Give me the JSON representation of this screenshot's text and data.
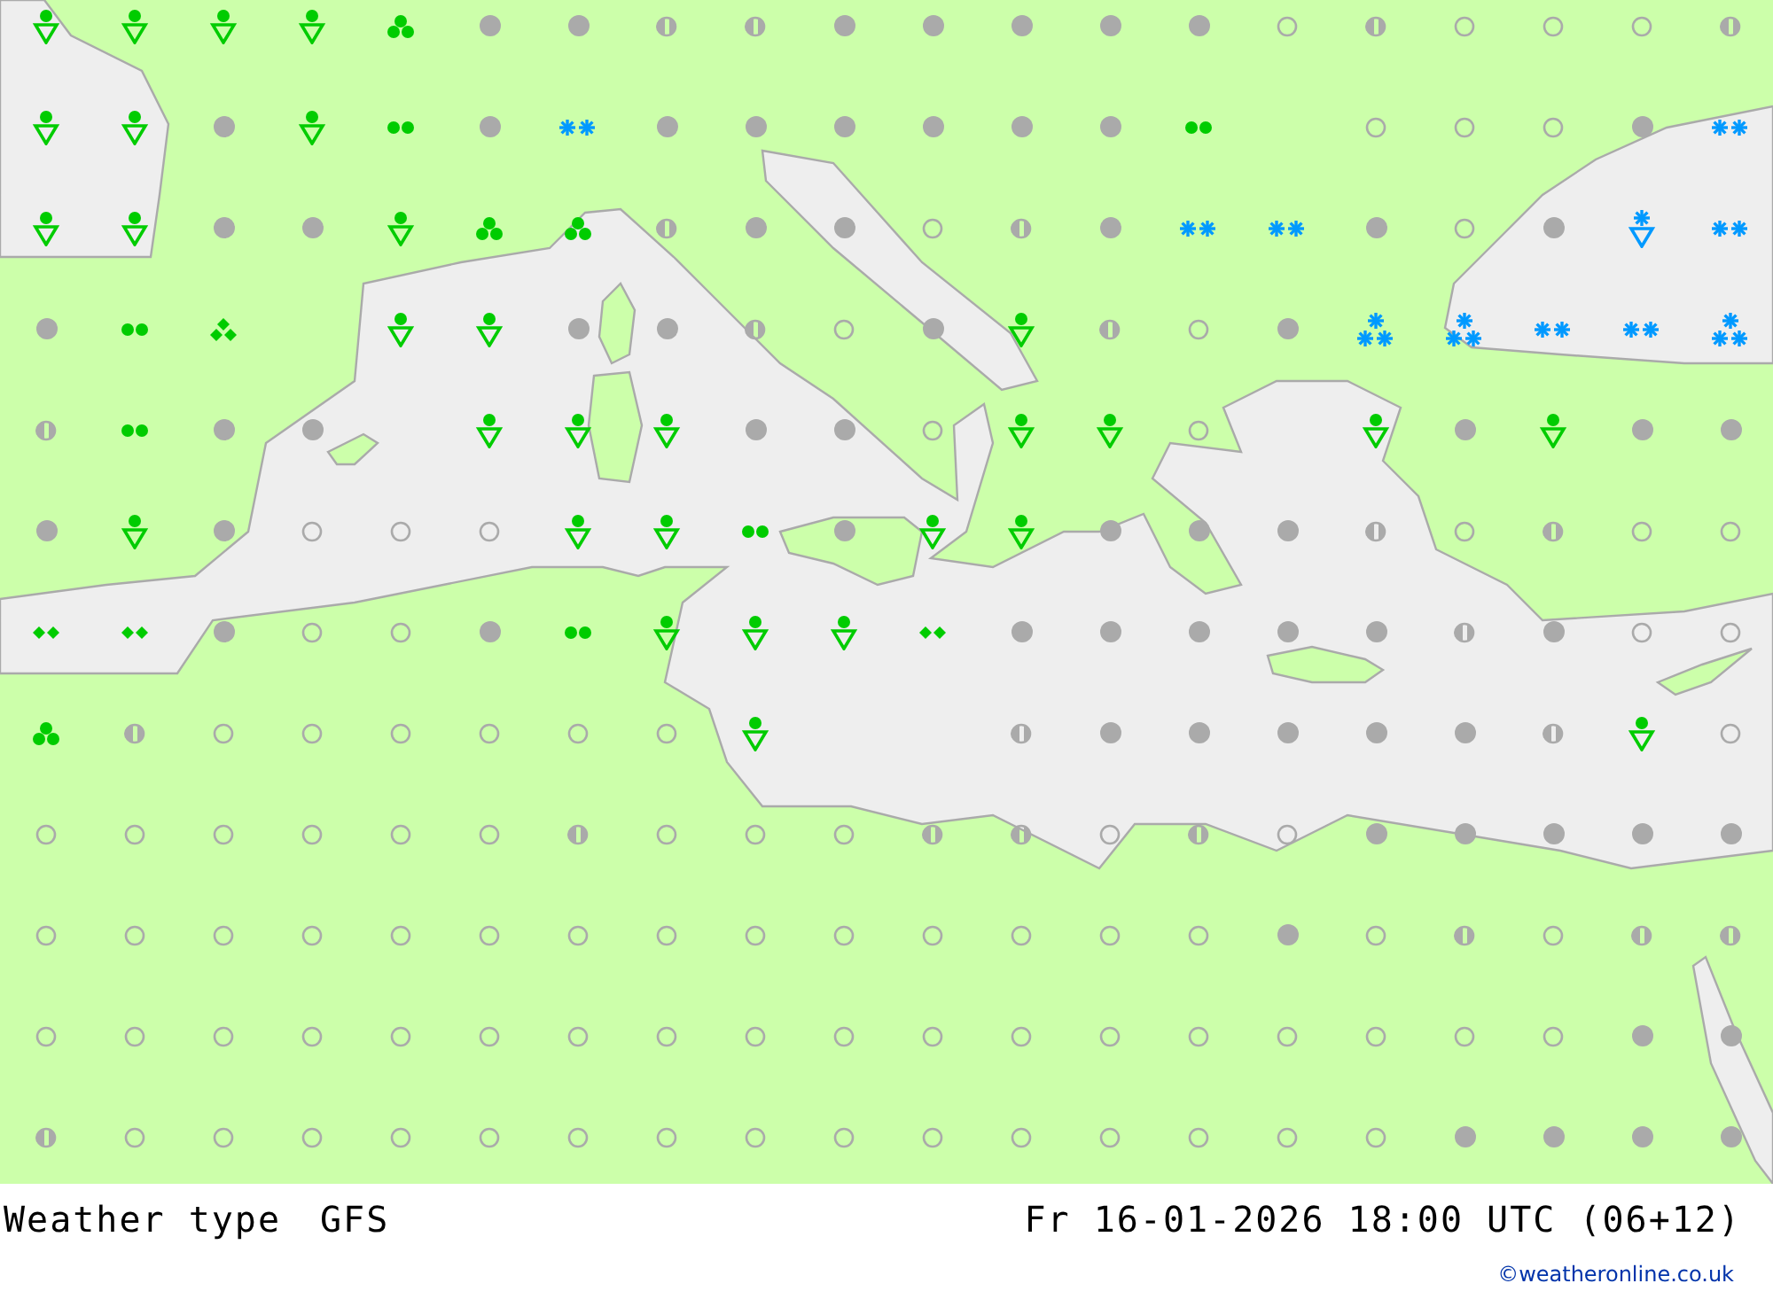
{
  "map": {
    "rows": [
      {
        "cells": [
          {
            "kind": "shower"
          },
          {
            "kind": "shower"
          },
          {
            "kind": "shower"
          },
          {
            "kind": "shower"
          },
          {
            "kind": "rain"
          },
          {
            "kind": "cloudy"
          },
          {
            "kind": "cloudy"
          },
          {
            "kind": "partly"
          },
          {
            "kind": "partly"
          },
          {
            "kind": "cloudy"
          },
          {
            "kind": "cloudy"
          },
          {
            "kind": "cloudy"
          },
          {
            "kind": "cloudy"
          },
          {
            "kind": "cloudy"
          },
          {
            "kind": "clear"
          },
          {
            "kind": "partly"
          },
          {
            "kind": "clear"
          },
          {
            "kind": "clear"
          },
          {
            "kind": "clear"
          },
          {
            "kind": "partly"
          }
        ]
      },
      {
        "cells": [
          {
            "kind": "shower"
          },
          {
            "kind": "shower"
          },
          {
            "kind": "cloudy"
          },
          {
            "kind": "shower"
          },
          {
            "kind": "rain-light"
          },
          {
            "kind": "cloudy"
          },
          {
            "kind": "snow"
          },
          {
            "kind": "cloudy"
          },
          {
            "kind": "cloudy"
          },
          {
            "kind": "cloudy"
          },
          {
            "kind": "cloudy"
          },
          {
            "kind": "cloudy"
          },
          {
            "kind": "cloudy"
          },
          {
            "kind": "rain-light"
          },
          {
            "kind": "empty"
          },
          {
            "kind": "clear"
          },
          {
            "kind": "clear"
          },
          {
            "kind": "clear"
          },
          {
            "kind": "cloudy"
          },
          {
            "kind": "snow"
          }
        ]
      },
      {
        "cells": [
          {
            "kind": "shower"
          },
          {
            "kind": "shower"
          },
          {
            "kind": "cloudy"
          },
          {
            "kind": "cloudy"
          },
          {
            "kind": "shower"
          },
          {
            "kind": "rain"
          },
          {
            "kind": "rain"
          },
          {
            "kind": "partly"
          },
          {
            "kind": "cloudy"
          },
          {
            "kind": "cloudy"
          },
          {
            "kind": "clear"
          },
          {
            "kind": "partly"
          },
          {
            "kind": "cloudy"
          },
          {
            "kind": "snow"
          },
          {
            "kind": "snow"
          },
          {
            "kind": "cloudy"
          },
          {
            "kind": "clear"
          },
          {
            "kind": "cloudy"
          },
          {
            "kind": "snow-shower"
          },
          {
            "kind": "snow"
          }
        ]
      },
      {
        "cells": [
          {
            "kind": "cloudy"
          },
          {
            "kind": "rain-light"
          },
          {
            "kind": "drizzle-heavy"
          },
          {
            "kind": "empty"
          },
          {
            "kind": "shower"
          },
          {
            "kind": "shower"
          },
          {
            "kind": "cloudy"
          },
          {
            "kind": "cloudy"
          },
          {
            "kind": "partly"
          },
          {
            "kind": "clear"
          },
          {
            "kind": "cloudy"
          },
          {
            "kind": "shower"
          },
          {
            "kind": "partly"
          },
          {
            "kind": "clear"
          },
          {
            "kind": "cloudy"
          },
          {
            "kind": "snow-heavy"
          },
          {
            "kind": "snow-heavy"
          },
          {
            "kind": "snow"
          },
          {
            "kind": "snow"
          },
          {
            "kind": "snow-heavy"
          }
        ]
      },
      {
        "cells": [
          {
            "kind": "partly"
          },
          {
            "kind": "rain-light"
          },
          {
            "kind": "cloudy"
          },
          {
            "kind": "cloudy"
          },
          {
            "kind": "empty"
          },
          {
            "kind": "shower"
          },
          {
            "kind": "shower"
          },
          {
            "kind": "shower"
          },
          {
            "kind": "cloudy"
          },
          {
            "kind": "cloudy"
          },
          {
            "kind": "clear"
          },
          {
            "kind": "shower"
          },
          {
            "kind": "shower"
          },
          {
            "kind": "clear"
          },
          {
            "kind": "empty"
          },
          {
            "kind": "shower"
          },
          {
            "kind": "cloudy"
          },
          {
            "kind": "shower"
          },
          {
            "kind": "cloudy"
          },
          {
            "kind": "cloudy"
          }
        ]
      },
      {
        "cells": [
          {
            "kind": "cloudy"
          },
          {
            "kind": "shower"
          },
          {
            "kind": "cloudy"
          },
          {
            "kind": "clear"
          },
          {
            "kind": "clear"
          },
          {
            "kind": "clear"
          },
          {
            "kind": "shower"
          },
          {
            "kind": "shower"
          },
          {
            "kind": "rain-light"
          },
          {
            "kind": "cloudy"
          },
          {
            "kind": "shower"
          },
          {
            "kind": "shower"
          },
          {
            "kind": "cloudy"
          },
          {
            "kind": "cloudy"
          },
          {
            "kind": "cloudy"
          },
          {
            "kind": "partly"
          },
          {
            "kind": "clear"
          },
          {
            "kind": "partly"
          },
          {
            "kind": "clear"
          },
          {
            "kind": "clear"
          }
        ]
      },
      {
        "cells": [
          {
            "kind": "drizzle"
          },
          {
            "kind": "drizzle"
          },
          {
            "kind": "cloudy"
          },
          {
            "kind": "clear"
          },
          {
            "kind": "clear"
          },
          {
            "kind": "cloudy"
          },
          {
            "kind": "rain-light"
          },
          {
            "kind": "shower"
          },
          {
            "kind": "shower"
          },
          {
            "kind": "shower"
          },
          {
            "kind": "drizzle"
          },
          {
            "kind": "cloudy"
          },
          {
            "kind": "cloudy"
          },
          {
            "kind": "cloudy"
          },
          {
            "kind": "cloudy"
          },
          {
            "kind": "cloudy"
          },
          {
            "kind": "partly"
          },
          {
            "kind": "cloudy"
          },
          {
            "kind": "clear"
          },
          {
            "kind": "clear"
          }
        ]
      },
      {
        "cells": [
          {
            "kind": "rain"
          },
          {
            "kind": "partly"
          },
          {
            "kind": "clear"
          },
          {
            "kind": "clear"
          },
          {
            "kind": "clear"
          },
          {
            "kind": "clear"
          },
          {
            "kind": "clear"
          },
          {
            "kind": "clear"
          },
          {
            "kind": "shower"
          },
          {
            "kind": "empty"
          },
          {
            "kind": "empty"
          },
          {
            "kind": "partly"
          },
          {
            "kind": "cloudy"
          },
          {
            "kind": "cloudy"
          },
          {
            "kind": "cloudy"
          },
          {
            "kind": "cloudy"
          },
          {
            "kind": "cloudy"
          },
          {
            "kind": "partly"
          },
          {
            "kind": "shower"
          },
          {
            "kind": "clear"
          }
        ]
      },
      {
        "cells": [
          {
            "kind": "clear"
          },
          {
            "kind": "clear"
          },
          {
            "kind": "clear"
          },
          {
            "kind": "clear"
          },
          {
            "kind": "clear"
          },
          {
            "kind": "clear"
          },
          {
            "kind": "partly"
          },
          {
            "kind": "clear"
          },
          {
            "kind": "clear"
          },
          {
            "kind": "clear"
          },
          {
            "kind": "partly"
          },
          {
            "kind": "partly"
          },
          {
            "kind": "clear"
          },
          {
            "kind": "partly"
          },
          {
            "kind": "clear"
          },
          {
            "kind": "cloudy"
          },
          {
            "kind": "cloudy"
          },
          {
            "kind": "cloudy"
          },
          {
            "kind": "cloudy"
          },
          {
            "kind": "cloudy"
          }
        ]
      },
      {
        "cells": [
          {
            "kind": "clear"
          },
          {
            "kind": "clear"
          },
          {
            "kind": "clear"
          },
          {
            "kind": "clear"
          },
          {
            "kind": "clear"
          },
          {
            "kind": "clear"
          },
          {
            "kind": "clear"
          },
          {
            "kind": "clear"
          },
          {
            "kind": "clear"
          },
          {
            "kind": "clear"
          },
          {
            "kind": "clear"
          },
          {
            "kind": "clear"
          },
          {
            "kind": "clear"
          },
          {
            "kind": "clear"
          },
          {
            "kind": "cloudy"
          },
          {
            "kind": "clear"
          },
          {
            "kind": "partly"
          },
          {
            "kind": "clear"
          },
          {
            "kind": "partly"
          },
          {
            "kind": "partly"
          }
        ]
      },
      {
        "cells": [
          {
            "kind": "clear"
          },
          {
            "kind": "clear"
          },
          {
            "kind": "clear"
          },
          {
            "kind": "clear"
          },
          {
            "kind": "clear"
          },
          {
            "kind": "clear"
          },
          {
            "kind": "clear"
          },
          {
            "kind": "clear"
          },
          {
            "kind": "clear"
          },
          {
            "kind": "clear"
          },
          {
            "kind": "clear"
          },
          {
            "kind": "clear"
          },
          {
            "kind": "clear"
          },
          {
            "kind": "clear"
          },
          {
            "kind": "clear"
          },
          {
            "kind": "clear"
          },
          {
            "kind": "clear"
          },
          {
            "kind": "clear"
          },
          {
            "kind": "cloudy"
          },
          {
            "kind": "cloudy"
          }
        ]
      },
      {
        "cells": [
          {
            "kind": "partly"
          },
          {
            "kind": "clear"
          },
          {
            "kind": "clear"
          },
          {
            "kind": "clear"
          },
          {
            "kind": "clear"
          },
          {
            "kind": "clear"
          },
          {
            "kind": "clear"
          },
          {
            "kind": "clear"
          },
          {
            "kind": "clear"
          },
          {
            "kind": "clear"
          },
          {
            "kind": "clear"
          },
          {
            "kind": "clear"
          },
          {
            "kind": "clear"
          },
          {
            "kind": "clear"
          },
          {
            "kind": "clear"
          },
          {
            "kind": "clear"
          },
          {
            "kind": "cloudy"
          },
          {
            "kind": "cloudy"
          },
          {
            "kind": "cloudy"
          },
          {
            "kind": "cloudy"
          }
        ]
      }
    ]
  },
  "caption": {
    "title": "Weather type",
    "model": "GFS",
    "valid_time": "Fr 16-01-2026 18:00 UTC (06+12)",
    "credit": "©weatheronline.co.uk"
  }
}
